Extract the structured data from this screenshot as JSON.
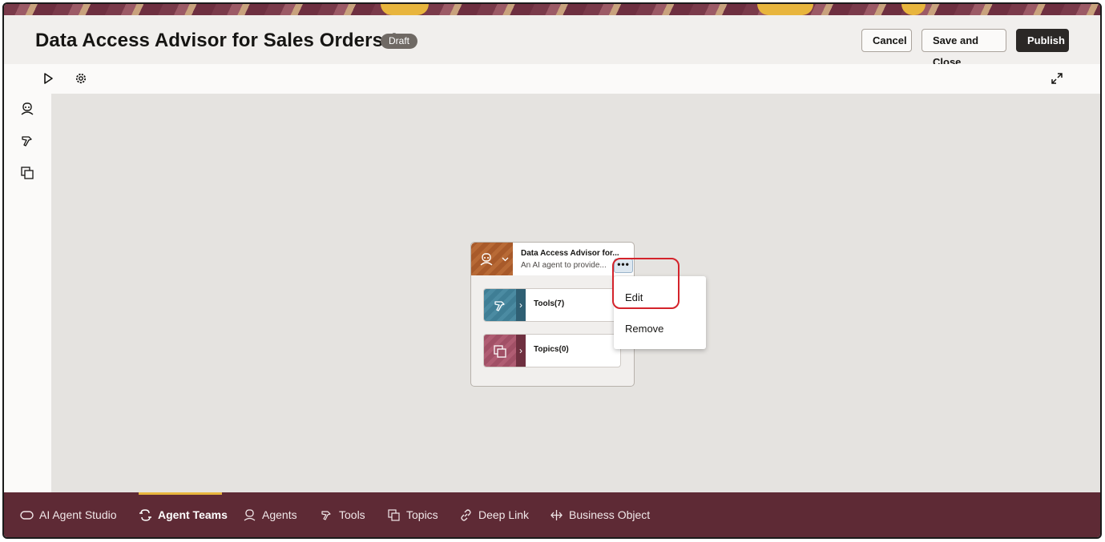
{
  "header": {
    "title": "Data Access Advisor for Sales Orders 1",
    "status_badge": "Draft",
    "buttons": {
      "cancel": "Cancel",
      "save_close": "Save and Close",
      "publish": "Publish"
    }
  },
  "toolbar": {
    "icons": [
      "play-icon",
      "gear-icon",
      "expand-icon"
    ]
  },
  "left_rail": {
    "icons": [
      "agent-icon",
      "tools-icon",
      "topics-icon"
    ]
  },
  "agent_card": {
    "title": "Data Access Advisor for...",
    "subtitle": "An AI agent to provide...",
    "more_label": "•••",
    "tools_label": "Tools(7)",
    "topics_label": "Topics(0)"
  },
  "context_menu": {
    "items": [
      "Edit",
      "Remove"
    ]
  },
  "bottom_nav": {
    "items": [
      {
        "label": "AI Agent Studio",
        "icon": "pill-icon"
      },
      {
        "label": "Agent Teams",
        "icon": "agent-teams-icon",
        "active": true
      },
      {
        "label": "Agents",
        "icon": "agent-icon"
      },
      {
        "label": "Tools",
        "icon": "tools-icon"
      },
      {
        "label": "Topics",
        "icon": "topics-icon"
      },
      {
        "label": "Deep Link",
        "icon": "link-icon"
      },
      {
        "label": "Business Object",
        "icon": "business-object-icon"
      }
    ]
  },
  "colors": {
    "accent": "#e8b53d",
    "nav_bg": "#5e2a35",
    "highlight": "#d4232b",
    "publish_bg": "#2b2826"
  }
}
